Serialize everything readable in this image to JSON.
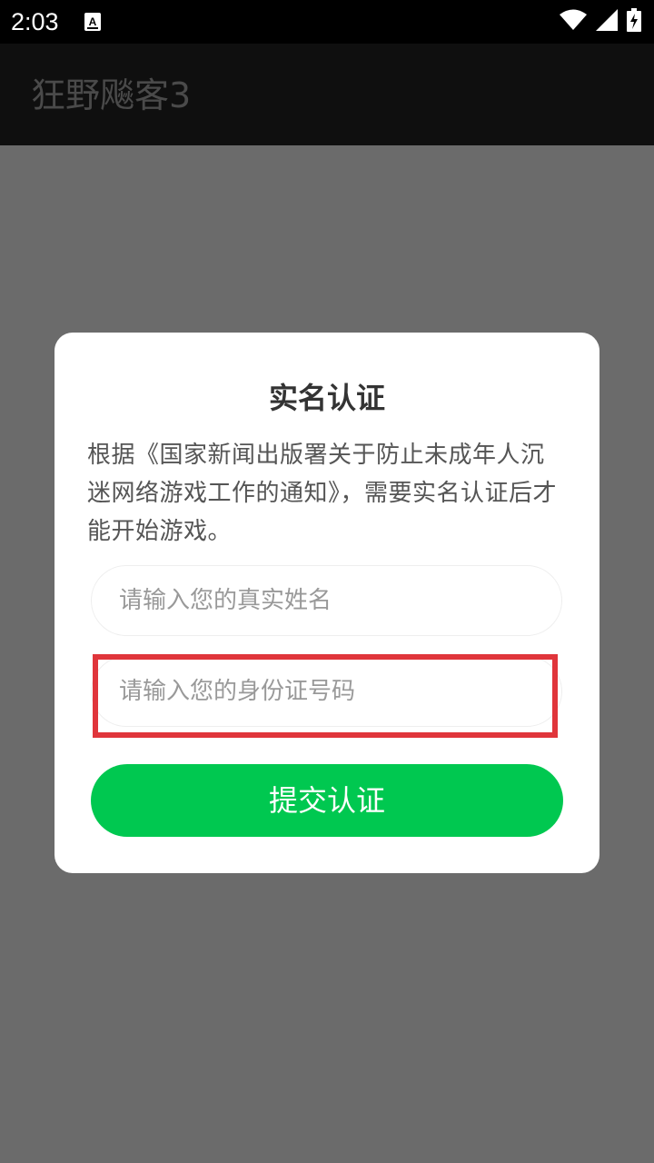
{
  "status_bar": {
    "time": "2:03",
    "icons": [
      "notification-a-icon",
      "wifi-icon",
      "signal-icon",
      "battery-charging-icon"
    ]
  },
  "app_bar": {
    "title": "狂野飚客3"
  },
  "dialog": {
    "title": "实名认证",
    "description": "根据《国家新闻出版署关于防止未成年人沉迷网络游戏工作的通知》，需要实名认证后才能开始游戏。",
    "name_field": {
      "value": "",
      "placeholder": "请输入您的真实姓名"
    },
    "id_field": {
      "value": "",
      "placeholder": "请输入您的身份证号码"
    },
    "submit_label": "提交认证"
  },
  "colors": {
    "accent": "#00c850",
    "highlight": "#e0353b",
    "overlay": "#6b6b6b",
    "app_bar": "#0f0f0f"
  }
}
